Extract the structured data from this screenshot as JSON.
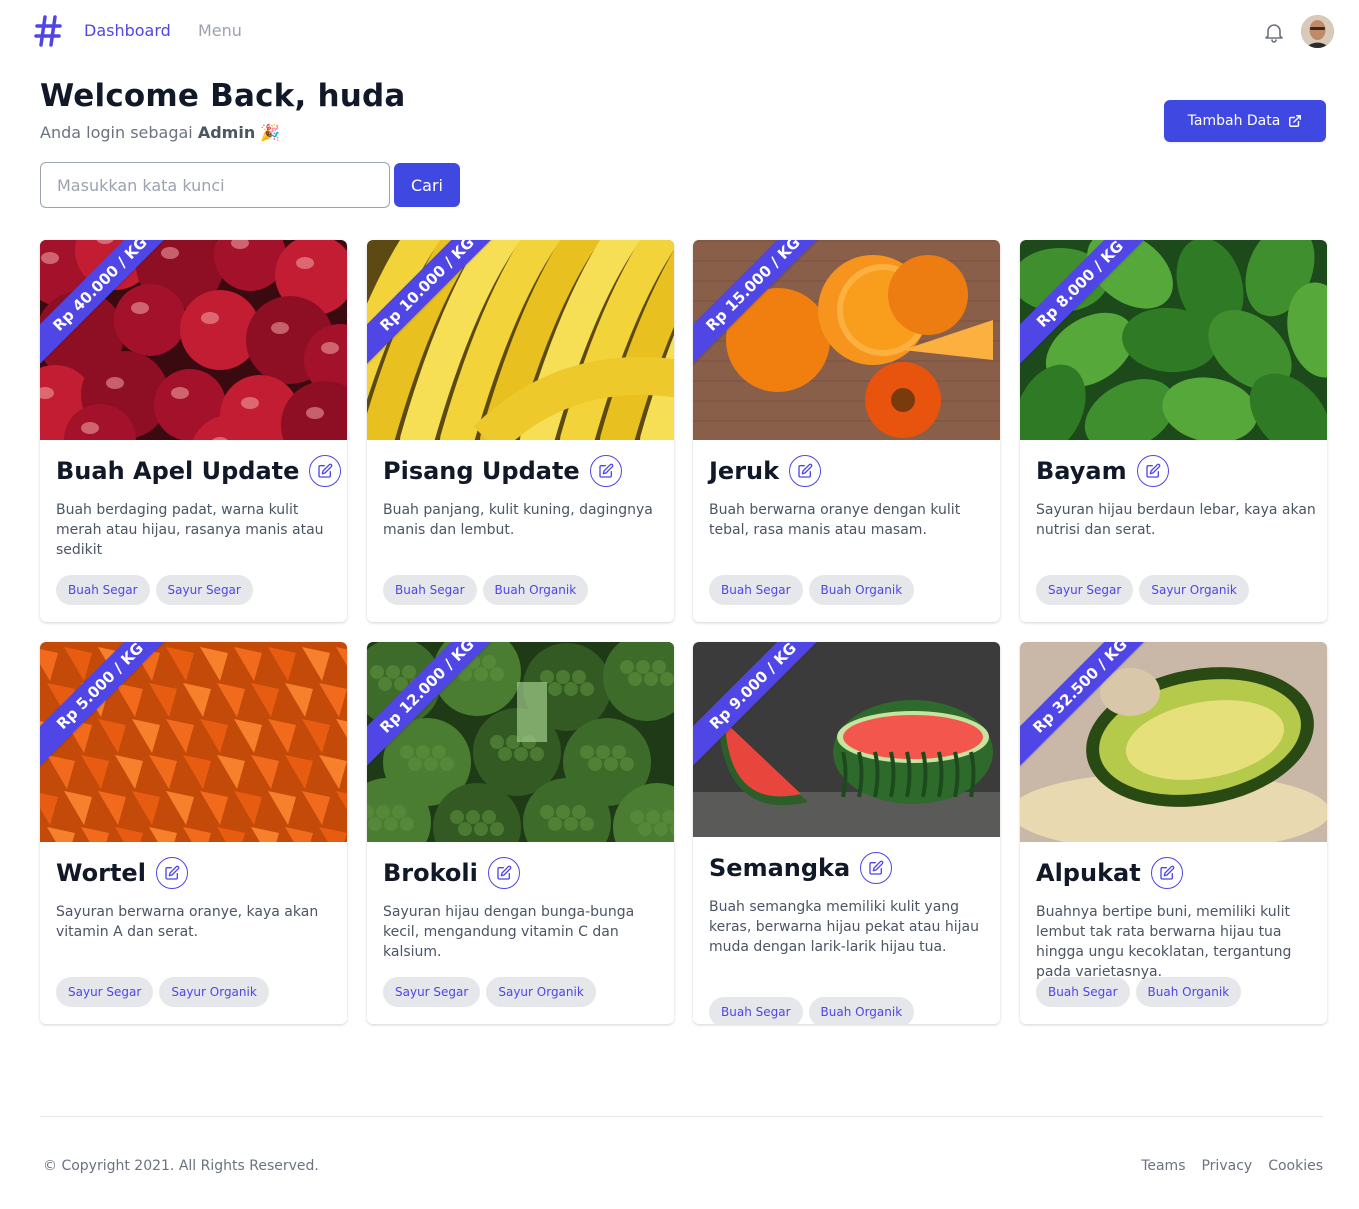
{
  "nav": {
    "links": [
      {
        "label": "Dashboard"
      },
      {
        "label": "Menu"
      }
    ]
  },
  "header": {
    "welcome": "Welcome Back, huda",
    "subtitle_prefix": "Anda login sebagai ",
    "role": "Admin",
    "emoji": "🎉",
    "add_button": "Tambah Data"
  },
  "search": {
    "placeholder": "Masukkan kata kunci",
    "button": "Cari"
  },
  "cards": [
    {
      "price": "Rp 40.000 / KG",
      "title": "Buah Apel Update",
      "desc": "Buah berdaging padat, warna kulit merah atau hijau, rasanya manis atau sedikit",
      "tags": [
        "Buah Segar",
        "Sayur Segar"
      ],
      "image": "apple"
    },
    {
      "price": "Rp 10.000 / KG",
      "title": "Pisang Update",
      "desc": "Buah panjang, kulit kuning, dagingnya manis dan lembut.",
      "tags": [
        "Buah Segar",
        "Buah Organik"
      ],
      "image": "banana"
    },
    {
      "price": "Rp 15.000 / KG",
      "title": "Jeruk",
      "desc": "Buah berwarna oranye dengan kulit tebal, rasa manis atau masam.",
      "tags": [
        "Buah Segar",
        "Buah Organik"
      ],
      "image": "orange"
    },
    {
      "price": "Rp 8.000 / KG",
      "title": "Bayam",
      "desc": "Sayuran hijau berdaun lebar, kaya akan nutrisi dan serat.",
      "tags": [
        "Sayur Segar",
        "Sayur Organik"
      ],
      "image": "spinach"
    },
    {
      "price": "Rp 5.000 / KG",
      "title": "Wortel",
      "desc": "Sayuran berwarna oranye, kaya akan vitamin A dan serat.",
      "tags": [
        "Sayur Segar",
        "Sayur Organik"
      ],
      "image": "carrot"
    },
    {
      "price": "Rp 12.000 / KG",
      "title": "Brokoli",
      "desc": "Sayuran hijau dengan bunga-bunga kecil, mengandung vitamin C dan kalsium.",
      "tags": [
        "Sayur Segar",
        "Sayur Organik"
      ],
      "image": "broccoli"
    },
    {
      "price": "Rp 9.000 / KG",
      "title": "Semangka",
      "desc": "Buah semangka memiliki kulit yang keras, berwarna hijau pekat atau hijau muda dengan larik-larik hijau tua.",
      "tags": [
        "Buah Segar",
        "Buah Organik"
      ],
      "image": "watermelon"
    },
    {
      "price": "Rp 32.500 / KG",
      "title": "Alpukat",
      "desc": "Buahnya bertipe buni, memiliki kulit lembut tak rata berwarna hijau tua hingga ungu kecoklatan, tergantung pada varietasnya.",
      "tags": [
        "Buah Segar",
        "Buah Organik"
      ],
      "image": "avocado"
    }
  ],
  "footer": {
    "copyright": "© Copyright 2021. All Rights Reserved.",
    "links": [
      "Teams",
      "Privacy",
      "Cookies"
    ]
  },
  "colors": {
    "primary": "#3f48e0",
    "accent": "#4f46e5",
    "tag_bg": "#e5e7eb"
  }
}
